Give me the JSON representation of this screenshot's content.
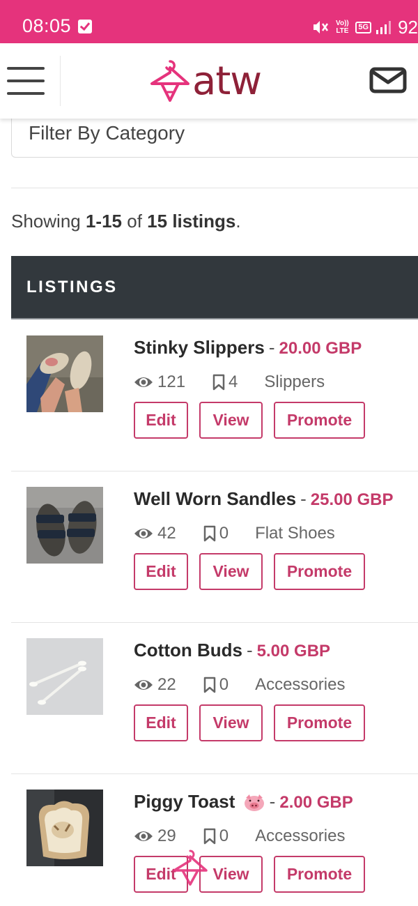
{
  "status_bar": {
    "time": "08:05",
    "network_volte": "Vo)) LTE",
    "network_5g": "5G",
    "battery": "92"
  },
  "header": {
    "logo_text": "atw"
  },
  "filter": {
    "label": "Filter By Category"
  },
  "summary": {
    "prefix": "Showing",
    "range": "1-15",
    "of": "of",
    "total": "15 listings",
    "suffix": "."
  },
  "listings_section": {
    "title": "LISTINGS"
  },
  "colors": {
    "status_bar": "#e5337c",
    "brand": "#8e2138",
    "accent": "#c43a69",
    "section_header": "#32383d"
  },
  "listings": [
    {
      "title": "Stinky Slippers",
      "price": "20.00 GBP",
      "views": "121",
      "saves": "4",
      "category": "Slippers",
      "edit_label": "Edit",
      "view_label": "View",
      "promote_label": "Promote"
    },
    {
      "title": "Well Worn Sandles",
      "price": "25.00 GBP",
      "views": "42",
      "saves": "0",
      "category": "Flat Shoes",
      "edit_label": "Edit",
      "view_label": "View",
      "promote_label": "Promote"
    },
    {
      "title": "Cotton Buds",
      "price": "5.00 GBP",
      "views": "22",
      "saves": "0",
      "category": "Accessories",
      "edit_label": "Edit",
      "view_label": "View",
      "promote_label": "Promote"
    },
    {
      "title": "Piggy Toast",
      "price": "2.00 GBP",
      "views": "29",
      "saves": "0",
      "category": "Accessories",
      "edit_label": "Edit",
      "view_label": "View",
      "promote_label": "Promote"
    }
  ]
}
